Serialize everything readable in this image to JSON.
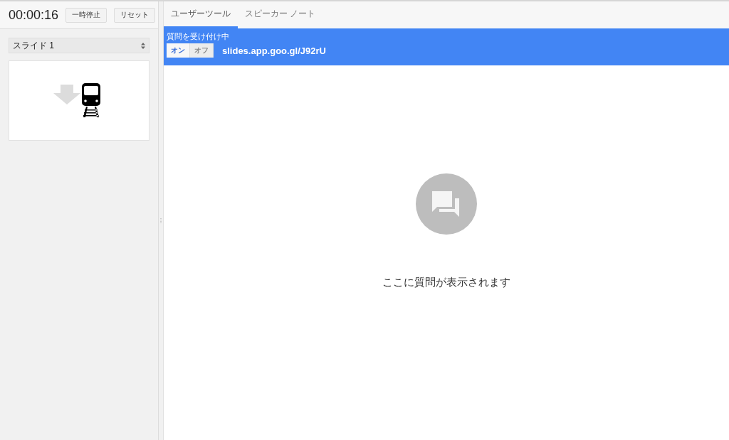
{
  "timer": {
    "time": "00:00:16",
    "buttons": [
      "一時停止",
      "リセット"
    ]
  },
  "slide_select": {
    "value": "スライド 1"
  },
  "tabs": [
    {
      "label": "ユーザーツール",
      "selected": true
    },
    {
      "label": "スピーカー ノート",
      "selected": false
    }
  ],
  "qa_banner": {
    "status": "質問を受け付け中",
    "toggle": [
      {
        "label": "オン",
        "selected": true
      },
      {
        "label": "オフ",
        "selected": false
      }
    ],
    "link": "slides.app.goo.gl/J92rU"
  },
  "empty_state": {
    "message": "ここに質問が表示されます"
  }
}
